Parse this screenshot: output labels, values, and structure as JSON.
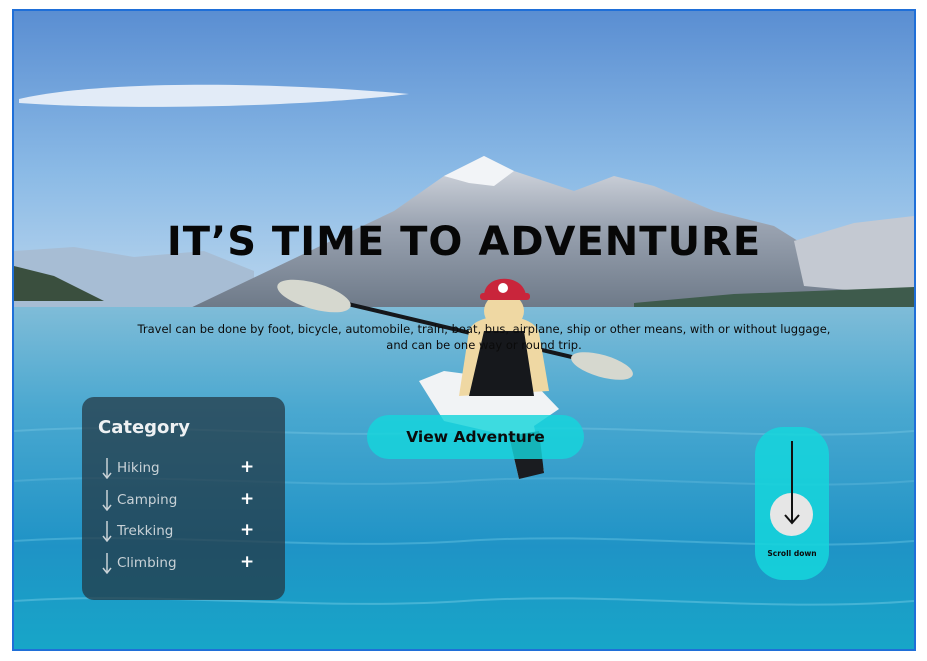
{
  "hero": {
    "headline": "IT’S TIME TO ADVENTURE",
    "description": "Travel can be done by foot, bicycle, automobile, train, boat, bus, airplane, ship or other means, with or without luggage, and can be one way or round trip.",
    "cta_label": "View Adventure"
  },
  "category": {
    "title": "Category",
    "items": [
      {
        "label": "Hiking"
      },
      {
        "label": "Camping"
      },
      {
        "label": "Trekking"
      },
      {
        "label": "Climbing"
      }
    ],
    "plus_symbol": "+"
  },
  "scroll": {
    "label": "Scroll down"
  },
  "colors": {
    "accent_cyan": "#15d6dc",
    "frame_border": "#1f6fd8",
    "panel_bg": "#233440",
    "sky": "#7fb2e6",
    "water": "#2a9fcf"
  },
  "icons": [
    "down-arrow-icon",
    "plus-icon",
    "scroll-down-arrow-icon"
  ]
}
